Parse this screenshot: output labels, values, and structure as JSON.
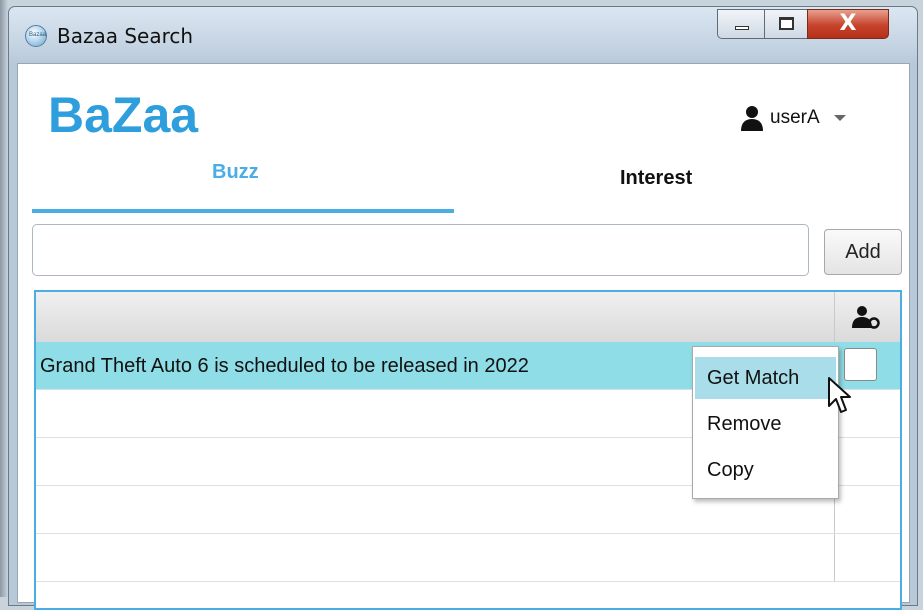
{
  "window": {
    "title": "Bazaa Search",
    "icon_text": "Bazaa",
    "close_glyph": "X"
  },
  "header": {
    "logo": "BaZaa",
    "user_name": "userA"
  },
  "tabs": [
    {
      "label": "Buzz",
      "active": true
    },
    {
      "label": "Interest",
      "active": false
    }
  ],
  "search": {
    "value": "",
    "placeholder": "",
    "add_label": "Add"
  },
  "table": {
    "header_icon": "user-gear-icon",
    "rows": [
      {
        "text": "Grand Theft Auto 6 is scheduled to be released in 2022",
        "selected": true
      },
      {
        "text": ""
      },
      {
        "text": ""
      },
      {
        "text": ""
      },
      {
        "text": ""
      }
    ]
  },
  "context_menu": {
    "items": [
      {
        "label": "Get Match",
        "highlighted": true
      },
      {
        "label": "Remove"
      },
      {
        "label": "Copy"
      }
    ]
  },
  "colors": {
    "accent": "#4aaee4",
    "logo": "#2e9fdc",
    "selected_row": "#8fdde6",
    "menu_highlight": "#a8dde9"
  }
}
